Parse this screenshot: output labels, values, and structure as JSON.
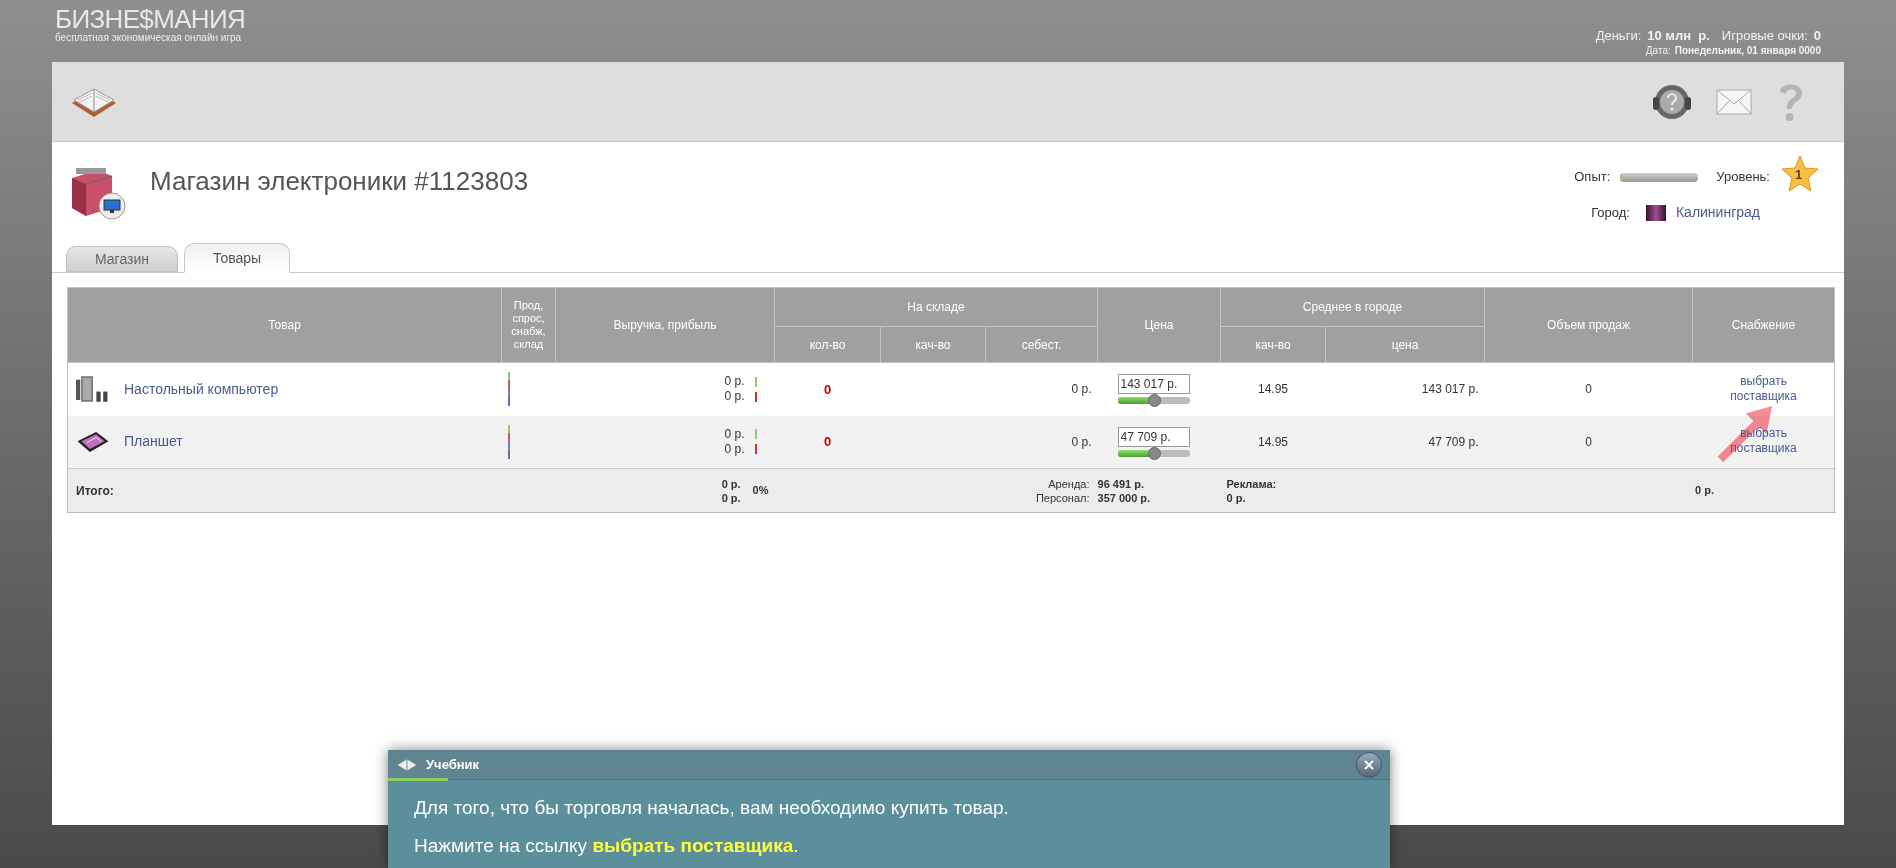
{
  "header": {
    "logo": "БИЗНЕ$МАНИЯ",
    "tagline": "бесплатная экономическая онлайн игра",
    "money_label": "Деньги:",
    "money": "10 млн  р.",
    "points_label": "Игровые очки:",
    "points": "0",
    "date_label": "Дата:",
    "date": "Понедельник, 01 января 0000"
  },
  "store": {
    "title": "Магазин электроники #1123803",
    "experience_label": "Опыт:",
    "experience": {
      "level": 0.02
    },
    "level_label": "Уровень:",
    "level_badge": "1",
    "city_label": "Город:",
    "city": "Калининград"
  },
  "tabs": [
    {
      "label": "Магазин",
      "selected": false
    },
    {
      "label": "Товары",
      "selected": true
    }
  ],
  "table": {
    "headers": {
      "product": "Товар",
      "indicators": "Прод, спрос, снабж, склад",
      "revenue": "Выручка, прибыль",
      "stock": "На складе",
      "stock_qty": "кол-во",
      "stock_quality": "кач-во",
      "stock_cost": "себест.",
      "price": "Цена",
      "city_avg": "Среднее в городе",
      "avg_quality": "кач-во",
      "avg_price": "цена",
      "sales": "Объем продаж",
      "supply": "Снабжение"
    },
    "rows": [
      {
        "kind": "computer",
        "name": "Настольный компьютер",
        "revenue": "0 р.",
        "profit": "0 р.",
        "stock_qty": "0",
        "cost": "0 р.",
        "price": "143 017 р.",
        "price_slider": {
          "level": 0.5
        },
        "avg_quality": "14.95",
        "avg_price": "143 017 р.",
        "sales": "0",
        "supply": "выбрать поставщика"
      },
      {
        "kind": "tablet",
        "name": "Планшет",
        "revenue": "0 р.",
        "profit": "0 р.",
        "stock_qty": "0",
        "cost": "0 р.",
        "price": "47 709 р.",
        "price_slider": {
          "level": 0.5
        },
        "avg_quality": "14.95",
        "avg_price": "47 709 р.",
        "sales": "0",
        "supply": "выбрать поставщика"
      }
    ],
    "total": {
      "label": "Итого:",
      "revenue": "0 р.",
      "profit": "0 р.",
      "percent": "0%",
      "rent_label": "Аренда:",
      "rent": "96 491 р.",
      "staff_label": "Персонал:",
      "staff": "357 000 р.",
      "ads_label": "Реклама:",
      "ads": "0 р.",
      "supply": "0 р."
    }
  },
  "tutorial": {
    "title": "Учебник",
    "progress": {
      "level": 0.06
    },
    "lines": [
      "Для того, что бы торговля началась, вам необходимо купить товар.",
      "Нажмите на ссылку **выбрать поставщика**."
    ]
  }
}
